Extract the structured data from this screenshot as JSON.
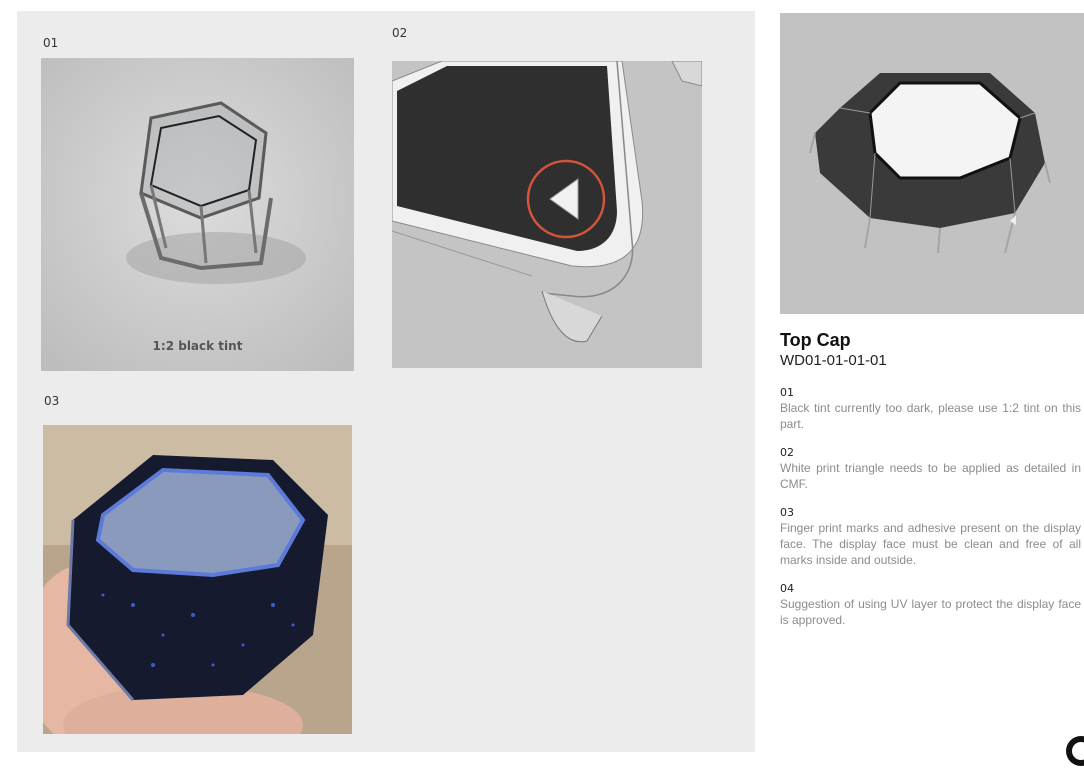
{
  "panel": {
    "items": [
      {
        "number": "01",
        "caption": "1:2 black tint"
      },
      {
        "number": "02"
      },
      {
        "number": "03"
      }
    ]
  },
  "part": {
    "title": "Top Cap",
    "code": "WD01-01-01-01"
  },
  "notes": [
    {
      "number": "01",
      "text": "Black tint currently too dark, please use 1:2 tint on this part."
    },
    {
      "number": "02",
      "text": "White print triangle needs to be applied as detailed in CMF."
    },
    {
      "number": "03",
      "text": "Finger print marks and adhesive present on the display face. The display face must be clean and free of all marks inside and outside."
    },
    {
      "number": "04",
      "text": "Suggestion of using UV layer to protect the display face is approved."
    }
  ],
  "colors": {
    "panel_bg": "#ececec",
    "highlight_circle": "#d2553a",
    "note_text": "#8c8c8c"
  }
}
